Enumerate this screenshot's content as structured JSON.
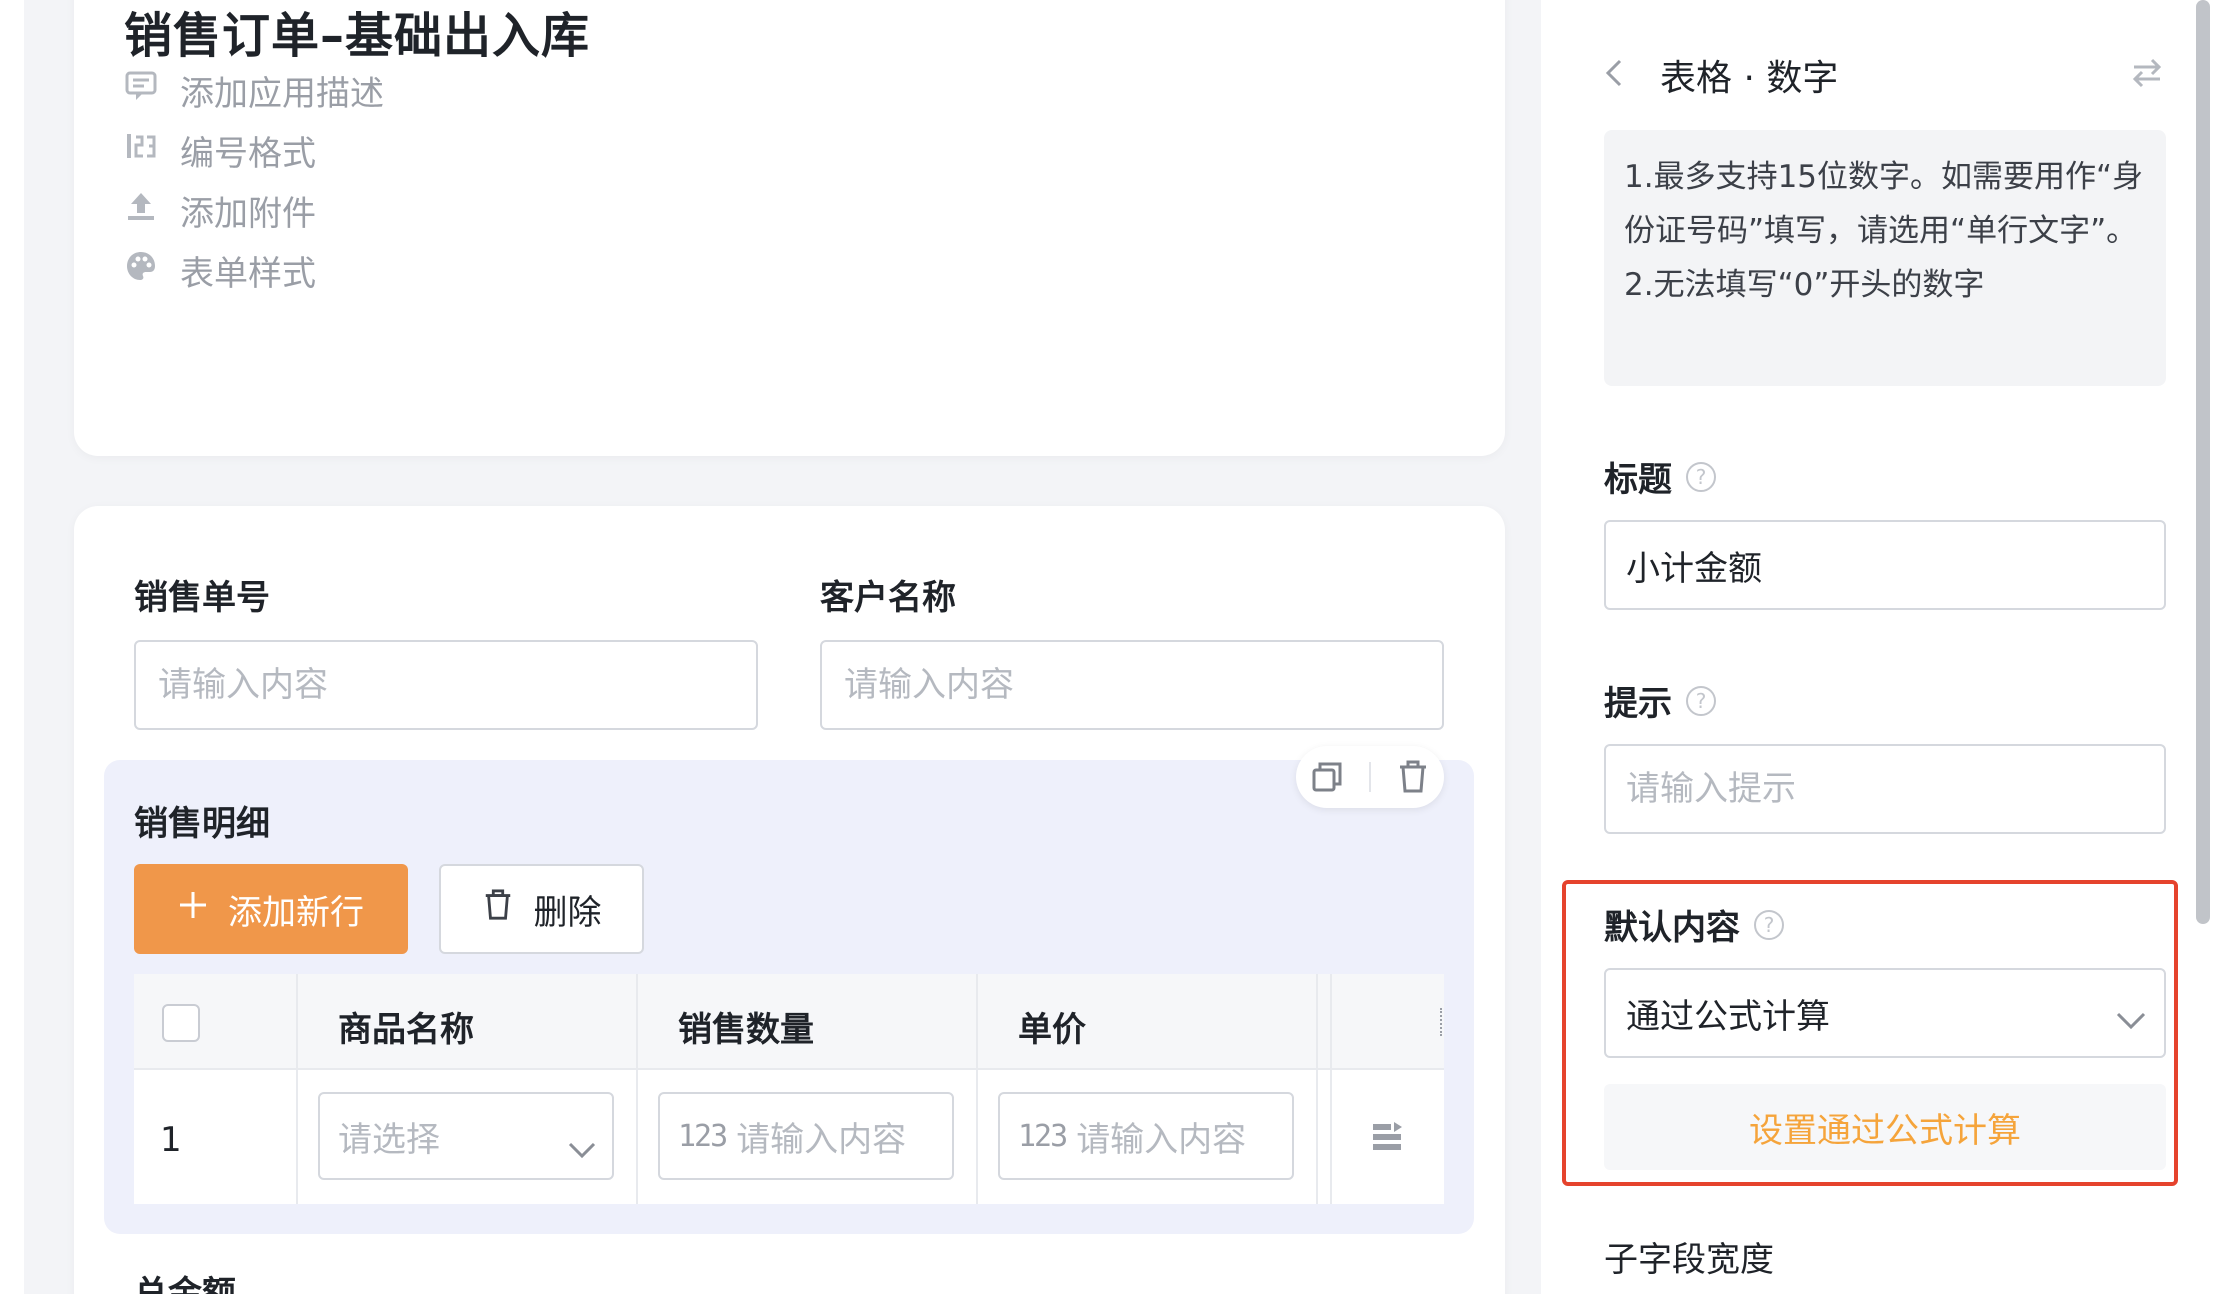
{
  "app": {
    "title": "销售订单–基础出入库",
    "menu": [
      {
        "label": "添加应用描述",
        "icon": "comment-icon"
      },
      {
        "label": "编号格式",
        "icon": "number-format-icon"
      },
      {
        "label": "添加附件",
        "icon": "upload-icon"
      },
      {
        "label": "表单样式",
        "icon": "palette-icon"
      }
    ]
  },
  "form": {
    "fields": [
      {
        "label": "销售单号",
        "placeholder": "请输入内容"
      },
      {
        "label": "客户名称",
        "placeholder": "请输入内容"
      }
    ],
    "subform": {
      "title": "销售明细",
      "add_label": "添加新行",
      "delete_label": "删除",
      "columns": [
        "商品名称",
        "销售数量",
        "单价"
      ],
      "rows": [
        {
          "index": "1",
          "product_placeholder": "请选择",
          "qty_placeholder": "请输入内容",
          "price_placeholder": "请输入内容"
        }
      ],
      "number_glyph": "123"
    },
    "partial_label": "总金额"
  },
  "panel": {
    "title": "表格 · 数字",
    "tips": [
      "1.最多支持15位数字。如需要用作“身份证号码”填写，请选用“单行文字”。",
      "2.无法填写“0”开头的数字"
    ],
    "title_label": "标题",
    "title_value": "小计金额",
    "hint_label": "提示",
    "hint_placeholder": "请输入提示",
    "default_label": "默认内容",
    "default_value": "通过公式计算",
    "formula_button": "设置通过公式计算",
    "subfield_width_label": "子字段宽度"
  },
  "colors": {
    "accent_orange": "#f0974a",
    "formula_text": "#f5a43b",
    "highlight_red": "#e5432d"
  }
}
